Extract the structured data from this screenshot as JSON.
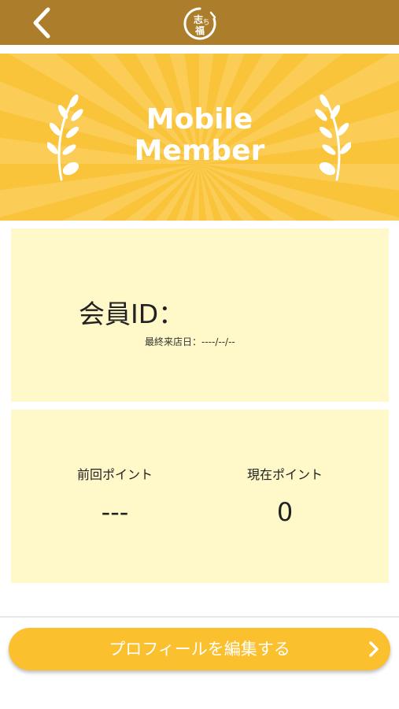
{
  "header": {
    "back_icon": "chevron-left-icon",
    "logo_icon": "shop-logo-icon",
    "logo_text": "志ち福"
  },
  "banner": {
    "title_line1": "Mobile",
    "title_line2": "Member",
    "decoration_icon": "laurel-icon"
  },
  "member": {
    "id_label": "会員ID：",
    "last_visit": "最終来店日：----/--/--"
  },
  "points": {
    "previous_label": "前回ポイント",
    "previous_value": "---",
    "current_label": "現在ポイント",
    "current_value": "0"
  },
  "actions": {
    "edit_profile_label": "プロフィールを編集する",
    "edit_profile_icon": "chevron-right-icon"
  },
  "colors": {
    "header_bg": "#ac7d2a",
    "banner_bg": "#f9c43a",
    "panel_bg": "#fff8c8",
    "button_bg": "#fbc02d"
  }
}
